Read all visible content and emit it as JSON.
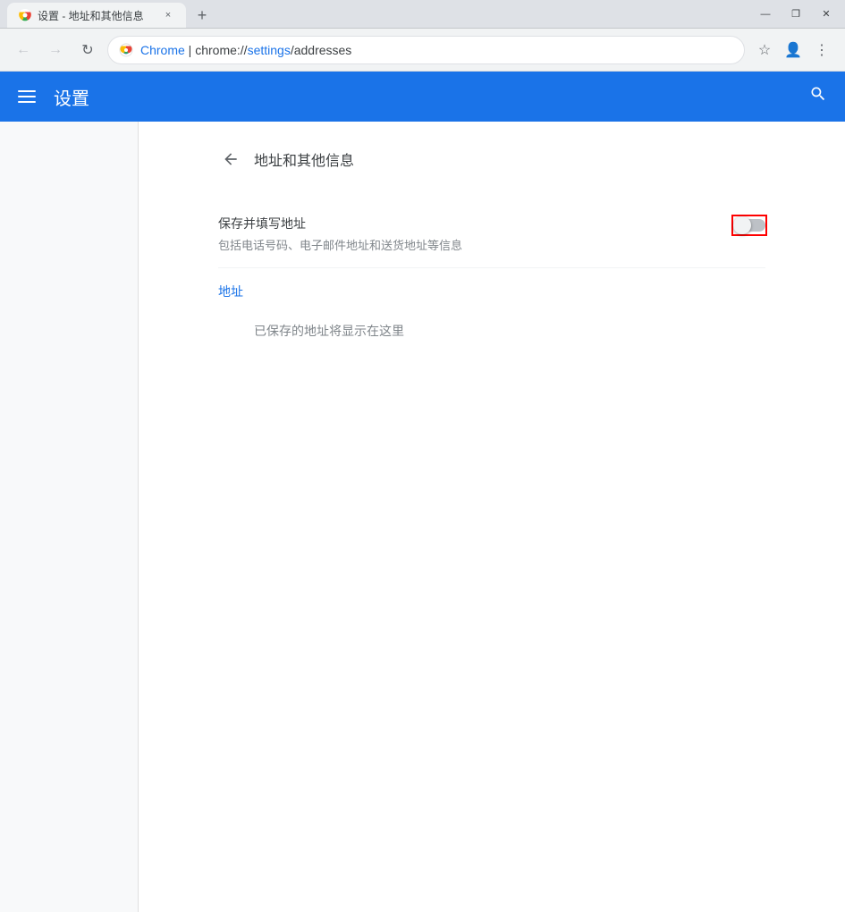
{
  "titlebar": {
    "tab_title": "设置 - 地址和其他信息",
    "tab_close_label": "×",
    "new_tab_label": "+",
    "win_minimize": "—",
    "win_restore": "❐",
    "win_close": "✕"
  },
  "addressbar": {
    "back_label": "←",
    "forward_label": "→",
    "reload_label": "↻",
    "brand": "Chrome",
    "separator": "|",
    "url_prefix": "chrome://",
    "url_settings": "settings",
    "url_path": "/addresses",
    "bookmark_label": "☆",
    "profile_label": "👤",
    "menu_label": "⋮"
  },
  "header": {
    "title": "设置",
    "search_icon": "search"
  },
  "settings": {
    "back_label": "←",
    "page_title": "地址和其他信息",
    "toggle_section": {
      "label": "保存并填写地址",
      "description": "包括电话号码、电子邮件地址和送货地址等信息",
      "toggle_state": false
    },
    "address_section": {
      "title": "地址",
      "empty_message": "已保存的地址将显示在这里"
    }
  }
}
